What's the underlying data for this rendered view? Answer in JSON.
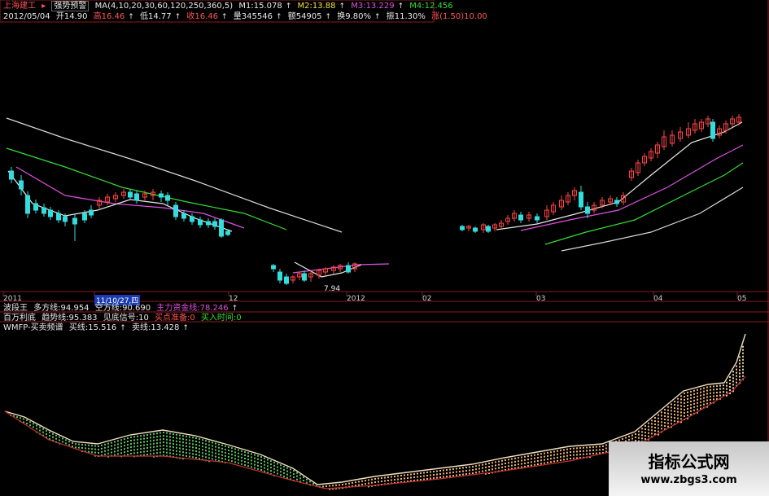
{
  "header": {
    "stock_name": "上海建工",
    "mode_label": "强势预警",
    "ma_spec": "MA(4,10,20,30,60,120,250,360,5)",
    "ma_values": [
      {
        "label": "M1:15.078",
        "color": "#e8e8e8"
      },
      {
        "label": "M2:13.88",
        "color": "#f0e040"
      },
      {
        "label": "M3:13.229",
        "color": "#e050e0"
      },
      {
        "label": "M4:12.456",
        "color": "#33dd33"
      }
    ],
    "date": "2012/05/04",
    "open": "开14.90",
    "high": "高16.46",
    "low": "低14.77",
    "close": "收16.46",
    "volume": "量345546",
    "amount": "额54905",
    "turnover": "换9.80%",
    "amplitude": "振11.30%",
    "change": "涨(1.50)10.00"
  },
  "price_chart": {
    "low_marker": "7.94",
    "dates": [
      {
        "label": "2011"
      },
      {
        "label": "11/10/27,四",
        "highlight": true
      },
      {
        "label": "12"
      },
      {
        "label": "2012"
      },
      {
        "label": "02"
      },
      {
        "label": "03"
      },
      {
        "label": "04"
      },
      {
        "label": "05"
      }
    ]
  },
  "indicator1": {
    "name": "波段王",
    "items": [
      {
        "label": "多方线:94.954",
        "color": "#e8e8e8"
      },
      {
        "label": "空方线:90.690",
        "color": "#e8e8e8"
      },
      {
        "label": "主力资金线:78.246",
        "color": "#e050e0"
      }
    ]
  },
  "indicator2": {
    "name": "百万利底",
    "items": [
      {
        "label": "趋势线:95.383",
        "color": "#e8e8e8"
      },
      {
        "label": "见底信号:10",
        "color": "#e8e8e8"
      },
      {
        "label": "买点准备:0",
        "color": "#ff5555"
      },
      {
        "label": "买入时间:0",
        "color": "#33dd33"
      }
    ]
  },
  "indicator3": {
    "name": "WMFP-买卖频谱",
    "items": [
      {
        "label": "买线:15.516",
        "color": "#e8e8e8"
      },
      {
        "label": "卖线:13.428",
        "color": "#e8e8e8"
      }
    ]
  },
  "watermark": {
    "title": "指标公式网",
    "url": "www.zbgs3.com"
  },
  "colors": {
    "up": "#ff4444",
    "down": "#33dddd",
    "grid": "#8a1a1a",
    "bg": "#000000"
  }
}
